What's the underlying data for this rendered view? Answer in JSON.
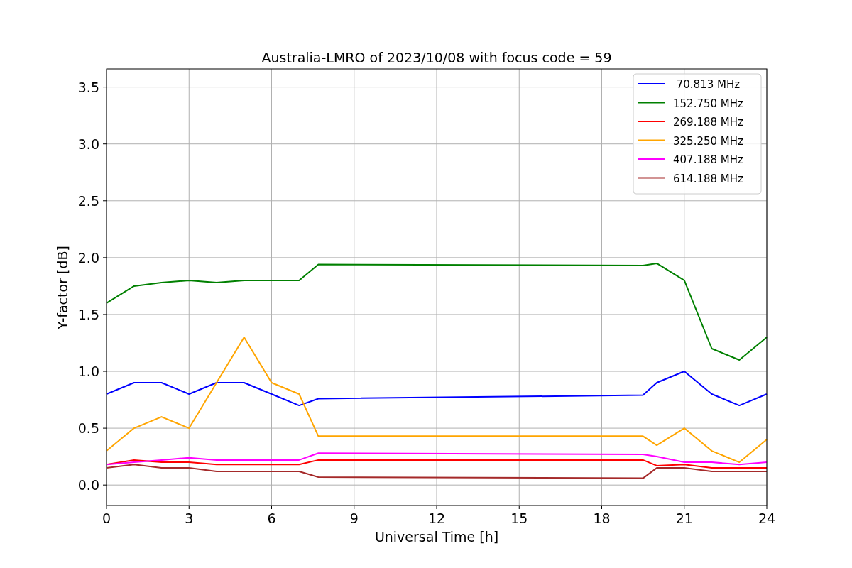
{
  "figure": {
    "chart_data": {
      "type": "line",
      "title": "Australia-LMRO of 2023/10/08 with focus code = 59",
      "xlabel": "Universal Time [h]",
      "ylabel": "Y-factor [dB]",
      "x": [
        0,
        1,
        2,
        3,
        4,
        5,
        6,
        7,
        7.7,
        19.5,
        20,
        21,
        22,
        23,
        24
      ],
      "series": [
        {
          "name": " 70.813 MHz",
          "color": "#0000ff",
          "values": [
            0.8,
            0.9,
            0.9,
            0.8,
            0.9,
            0.9,
            0.8,
            0.7,
            0.76,
            0.79,
            0.9,
            1.0,
            0.8,
            0.7,
            0.8
          ]
        },
        {
          "name": "152.750 MHz",
          "color": "#008000",
          "values": [
            1.6,
            1.75,
            1.78,
            1.8,
            1.78,
            1.8,
            1.8,
            1.8,
            1.94,
            1.93,
            1.95,
            1.8,
            1.2,
            1.1,
            1.3
          ]
        },
        {
          "name": "269.188 MHz",
          "color": "#ff0000",
          "values": [
            0.18,
            0.22,
            0.2,
            0.2,
            0.18,
            0.18,
            0.18,
            0.18,
            0.22,
            0.22,
            0.17,
            0.18,
            0.15,
            0.15,
            0.15
          ]
        },
        {
          "name": "325.250 MHz",
          "color": "#ffa500",
          "values": [
            0.3,
            0.5,
            0.6,
            0.5,
            0.9,
            1.3,
            0.9,
            0.8,
            0.43,
            0.43,
            0.35,
            0.5,
            0.3,
            0.2,
            0.4
          ]
        },
        {
          "name": "407.188 MHz",
          "color": "#ff00ff",
          "values": [
            0.18,
            0.2,
            0.22,
            0.24,
            0.22,
            0.22,
            0.22,
            0.22,
            0.28,
            0.27,
            0.25,
            0.2,
            0.2,
            0.18,
            0.2
          ]
        },
        {
          "name": "614.188 MHz",
          "color": "#a52a2a",
          "values": [
            0.15,
            0.18,
            0.15,
            0.15,
            0.12,
            0.12,
            0.12,
            0.12,
            0.07,
            0.06,
            0.15,
            0.15,
            0.12,
            0.12,
            0.12
          ]
        }
      ],
      "grid": true,
      "legend": true,
      "xlim": [
        0,
        24
      ],
      "ylim": [
        -0.18,
        3.66
      ],
      "xticks": [
        0,
        3,
        6,
        9,
        12,
        15,
        18,
        21,
        24
      ],
      "yticks": [
        {
          "value": 0,
          "label": "0.0"
        },
        {
          "value": 0.5,
          "label": "0.5"
        },
        {
          "value": 1,
          "label": "1.0"
        },
        {
          "value": 1.5,
          "label": "1.5"
        },
        {
          "value": 2,
          "label": "2.0"
        },
        {
          "value": 2.5,
          "label": "2.5"
        },
        {
          "value": 3,
          "label": "3.0"
        },
        {
          "value": 3.5,
          "label": "3.5"
        }
      ]
    }
  }
}
